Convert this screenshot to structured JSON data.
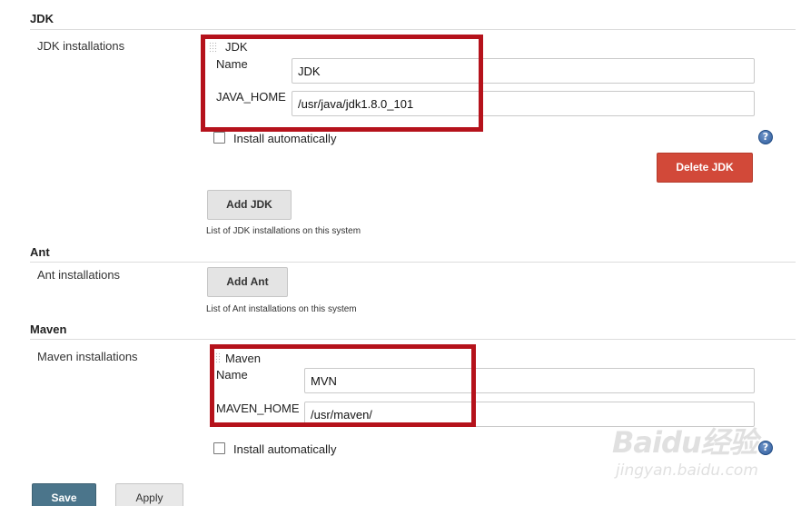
{
  "jdk": {
    "section_title": "JDK",
    "row_label": "JDK installations",
    "block_title": "JDK",
    "name_label": "Name",
    "name_value": "JDK",
    "home_label": "JAVA_HOME",
    "home_value": "/usr/java/jdk1.8.0_101",
    "install_auto_label": "Install automatically",
    "delete_button": "Delete JDK",
    "add_button": "Add JDK",
    "help_text": "List of JDK installations on this system"
  },
  "ant": {
    "section_title": "Ant",
    "row_label": "Ant installations",
    "add_button": "Add Ant",
    "help_text": "List of Ant installations on this system"
  },
  "maven": {
    "section_title": "Maven",
    "row_label": "Maven installations",
    "block_title": "Maven",
    "name_label": "Name",
    "name_value": "MVN",
    "home_label": "MAVEN_HOME",
    "home_value": "/usr/maven/",
    "install_auto_label": "Install automatically"
  },
  "footer": {
    "save_button": "Save",
    "apply_button": "Apply"
  },
  "help_icon_glyph": "?",
  "watermark": {
    "brand": "Baidu经验",
    "url": "jingyan.baidu.com"
  },
  "colors": {
    "highlight": "#b5121b",
    "delete": "#d24939",
    "save": "#4b758b",
    "help_icon": "#2f5c9c"
  }
}
